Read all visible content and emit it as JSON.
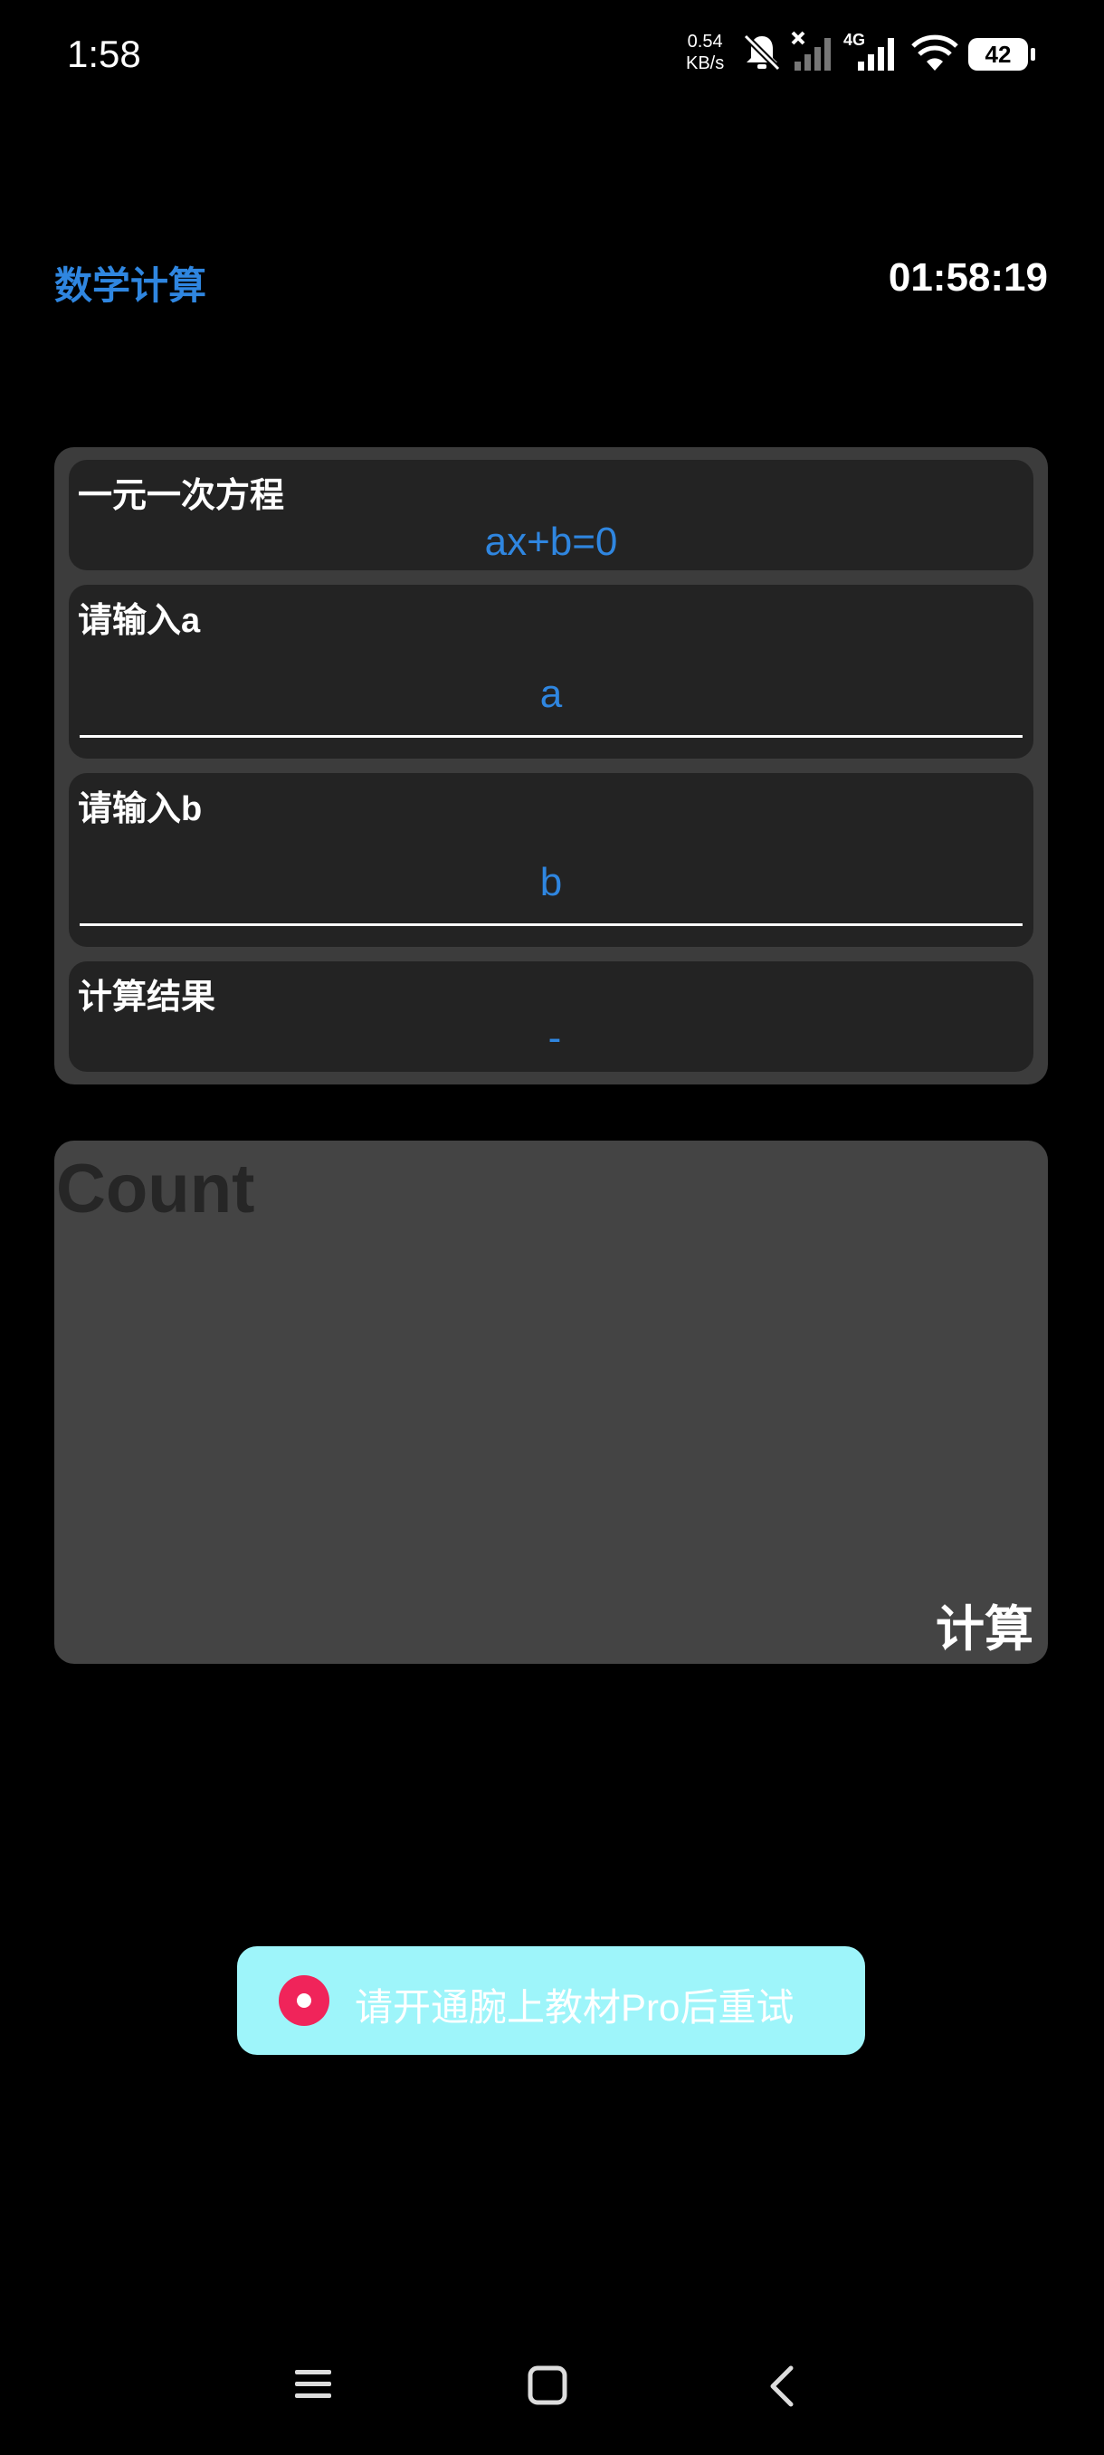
{
  "status_bar": {
    "time": "1:58",
    "net_speed_value": "0.54",
    "net_speed_unit": "KB/s",
    "network_type": "4G",
    "battery": "42",
    "icons": [
      "mute-icon",
      "no-signal-icon",
      "signal-4g-icon",
      "wifi-icon",
      "battery-icon"
    ]
  },
  "header": {
    "title": "数学计算",
    "clock": "01:58:19"
  },
  "equation_card": {
    "label": "一元一次方程",
    "formula": "ax+b=0"
  },
  "input_a": {
    "label": "请输入a",
    "placeholder": "a"
  },
  "input_b": {
    "label": "请输入b",
    "placeholder": "b"
  },
  "result_card": {
    "label": "计算结果",
    "value": "-"
  },
  "count_panel": {
    "label": "Count",
    "button_label": "计算"
  },
  "toast": {
    "message": "请开通腕上教材Pro后重试"
  },
  "nav_bar": {
    "items": [
      "menu-icon",
      "home-icon",
      "back-icon"
    ]
  },
  "colors": {
    "accent": "#2f86e0",
    "background": "#000000",
    "panel": "#3c3c3c",
    "card": "#232323",
    "toast_bg": "#9ef5fa",
    "toast_dot": "#f0245a"
  }
}
